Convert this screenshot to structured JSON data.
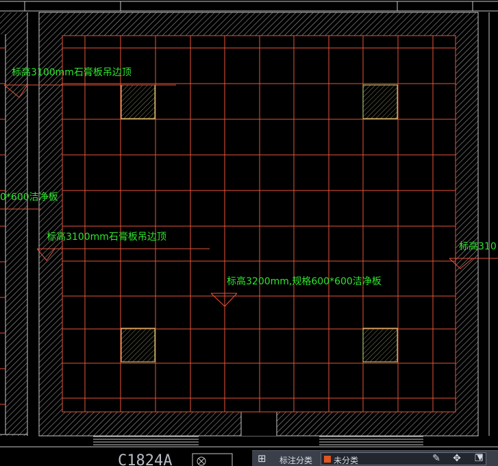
{
  "annotations": {
    "ceiling_upper": "标高3100mm石膏板吊边顶",
    "ceiling_left_partial": "0*600洁净板",
    "ceiling_middle": "标高3100mm石膏板吊边顶",
    "right_partial": "标高310",
    "main_panel": "标高3200mm,规格600*600洁净板"
  },
  "window_tag": "C1824A",
  "panel": {
    "category_label": "标注分类",
    "category_value": "未分类",
    "category_color": "#e2561e",
    "icons": [
      "grid-icon",
      "edit-icon",
      "move-icon",
      "copy-icon"
    ]
  },
  "colors": {
    "wall_line": "#c8c8c8",
    "grid_line": "#e8553a",
    "text": "#2ee62e",
    "vent": "#d8e07a"
  }
}
